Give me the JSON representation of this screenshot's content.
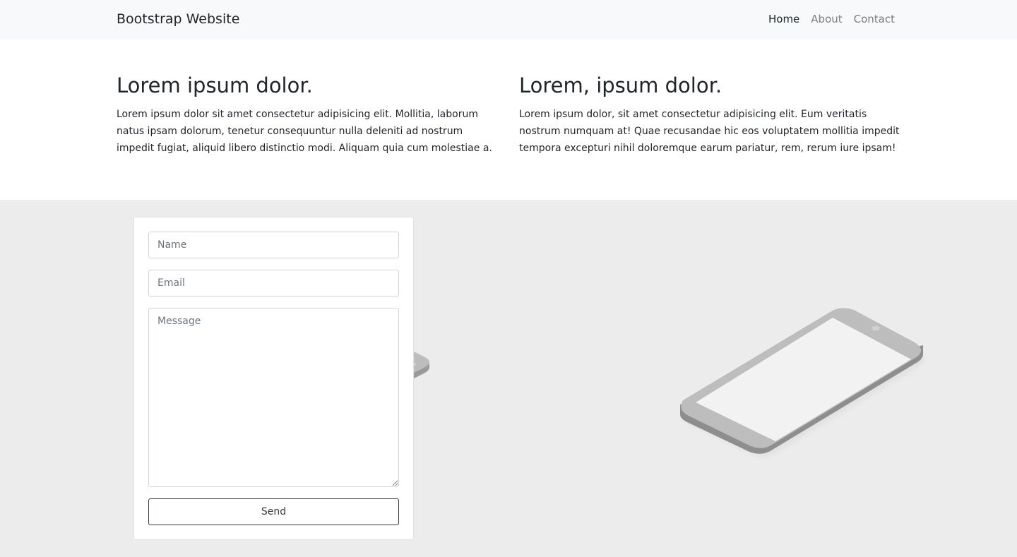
{
  "navbar": {
    "brand": "Bootstrap Website",
    "links": [
      {
        "label": "Home",
        "active": true
      },
      {
        "label": "About",
        "active": false
      },
      {
        "label": "Contact",
        "active": false
      }
    ]
  },
  "intro": {
    "columns": [
      {
        "heading": "Lorem ipsum dolor.",
        "body": "Lorem ipsum dolor sit amet consectetur adipisicing elit. Mollitia, laborum natus ipsam dolorum, tenetur consequuntur nulla deleniti ad nostrum impedit fugiat, aliquid libero distinctio modi. Aliquam quia cum molestiae a."
      },
      {
        "heading": "Lorem, ipsum dolor.",
        "body": "Lorem ipsum dolor, sit amet consectetur adipisicing elit. Eum veritatis nostrum numquam at! Quae recusandae hic eos voluptatem mollitia impedit tempora excepturi nihil doloremque earum pariatur, rem, rerum iure ipsam!"
      }
    ]
  },
  "contact_form": {
    "name": {
      "value": "",
      "placeholder": "Name"
    },
    "email": {
      "value": "",
      "placeholder": "Email"
    },
    "message": {
      "value": "",
      "placeholder": "Message"
    },
    "send_label": "Send"
  },
  "illustration": {
    "icon": "smartphone-illustration",
    "colors": {
      "section_background": "#ececec",
      "phone_body": "#bdbdbd",
      "phone_edge": "#8e8e8e",
      "phone_screen": "#f2f2f2"
    }
  }
}
